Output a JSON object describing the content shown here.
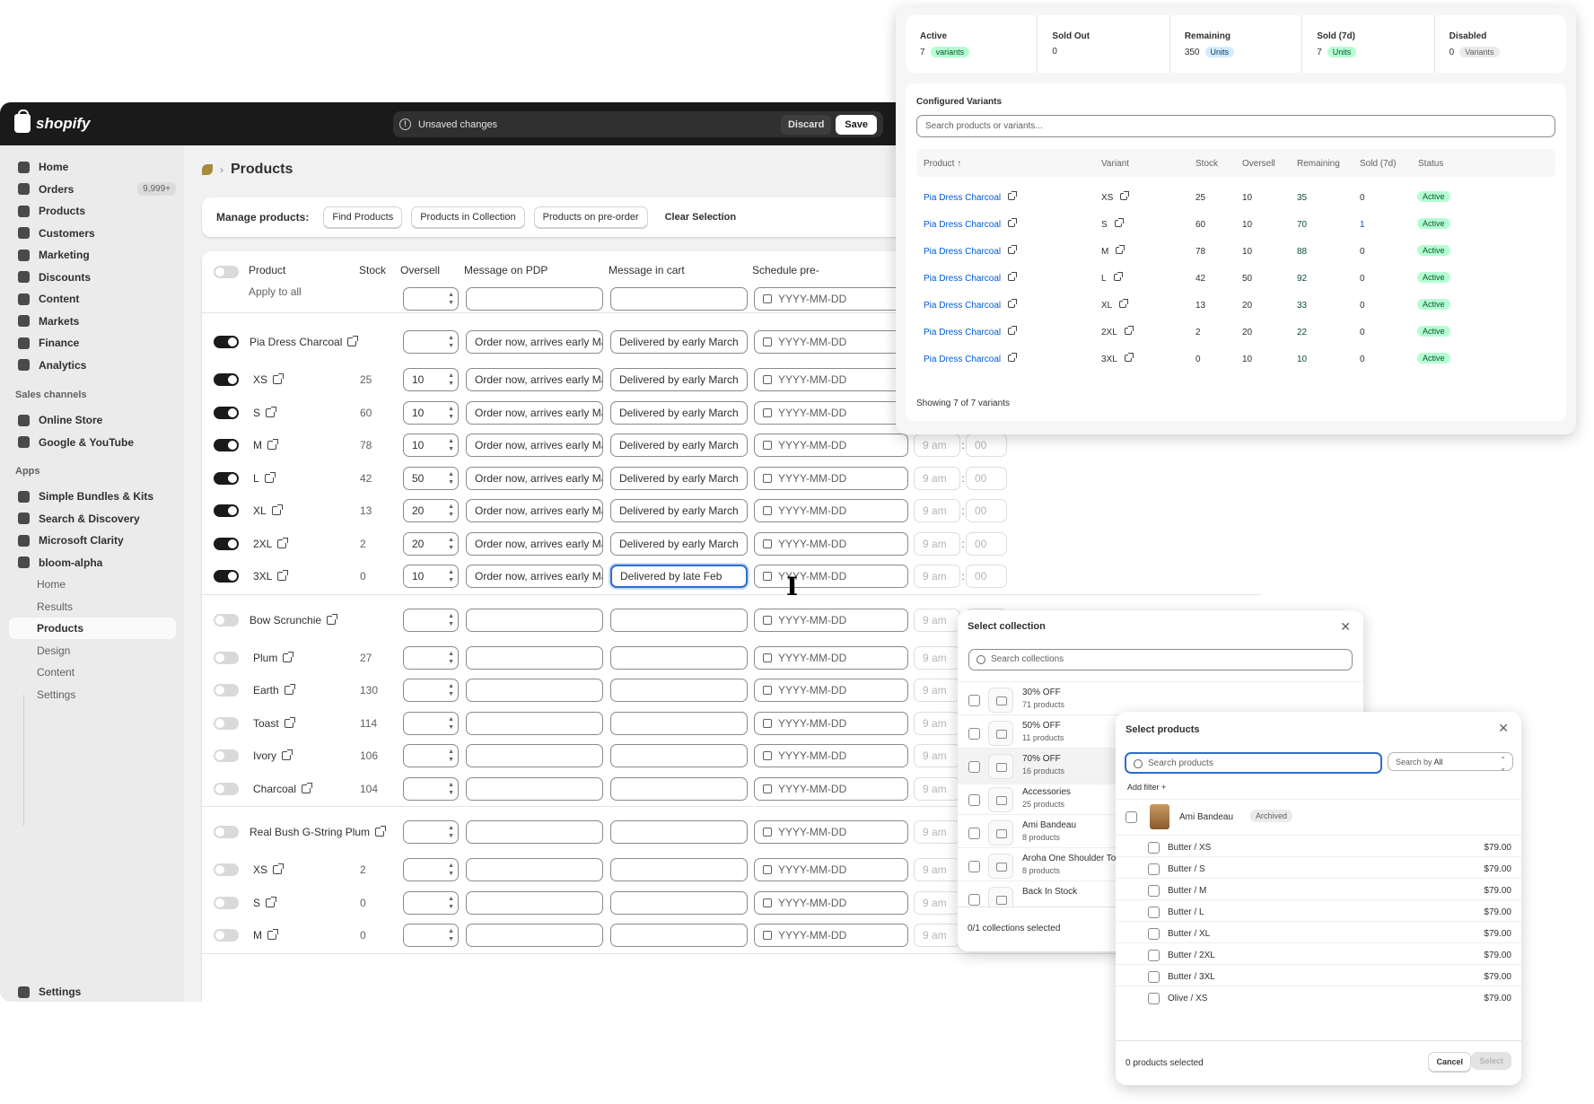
{
  "topbar": {
    "brand": "shopify",
    "unsaved": "Unsaved changes",
    "discard": "Discard",
    "save": "Save"
  },
  "sidebar": {
    "main": [
      {
        "label": "Home"
      },
      {
        "label": "Orders",
        "badge": "9,999+"
      },
      {
        "label": "Products"
      },
      {
        "label": "Customers"
      },
      {
        "label": "Marketing"
      },
      {
        "label": "Discounts"
      },
      {
        "label": "Content"
      },
      {
        "label": "Markets"
      },
      {
        "label": "Finance"
      },
      {
        "label": "Analytics"
      }
    ],
    "sales_heading": "Sales channels",
    "sales": [
      {
        "label": "Online Store"
      },
      {
        "label": "Google & YouTube"
      }
    ],
    "apps_heading": "Apps",
    "apps": [
      {
        "label": "Simple Bundles & Kits"
      },
      {
        "label": "Search & Discovery"
      },
      {
        "label": "Microsoft Clarity"
      },
      {
        "label": "bloom-alpha"
      }
    ],
    "app_sub": [
      {
        "label": "Home"
      },
      {
        "label": "Results"
      },
      {
        "label": "Products"
      },
      {
        "label": "Design"
      },
      {
        "label": "Content"
      },
      {
        "label": "Settings"
      }
    ],
    "settings": "Settings"
  },
  "page": {
    "title": "Products"
  },
  "manage": {
    "label": "Manage products:",
    "find": "Find Products",
    "in_collection": "Products in Collection",
    "preorder": "Products on pre-order",
    "clear": "Clear Selection"
  },
  "table": {
    "headers": {
      "product": "Product",
      "stock": "Stock",
      "oversell": "Oversell",
      "pdp": "Message on PDP",
      "cart": "Message in cart",
      "schedule": "Schedule pre-",
      "apply": "Apply to all"
    },
    "date_placeholder": "YYYY-MM-DD",
    "time": "9 am",
    "minutes": "00",
    "colon": ":",
    "groups": [
      {
        "name": "Pia Dress Charcoal",
        "on": true,
        "pdp": "Order now, arrives early Mar",
        "cart": "Delivered by early March",
        "variants": [
          {
            "name": "XS",
            "stock": "25",
            "oversell": "10",
            "pdp": "Order now, arrives early Mar",
            "cart": "Delivered by early March"
          },
          {
            "name": "S",
            "stock": "60",
            "oversell": "10",
            "pdp": "Order now, arrives early Mar",
            "cart": "Delivered by early March"
          },
          {
            "name": "M",
            "stock": "78",
            "oversell": "10",
            "pdp": "Order now, arrives early Mar",
            "cart": "Delivered by early March"
          },
          {
            "name": "L",
            "stock": "42",
            "oversell": "50",
            "pdp": "Order now, arrives early Mar",
            "cart": "Delivered by early March"
          },
          {
            "name": "XL",
            "stock": "13",
            "oversell": "20",
            "pdp": "Order now, arrives early Mar",
            "cart": "Delivered by early March"
          },
          {
            "name": "2XL",
            "stock": "2",
            "oversell": "20",
            "pdp": "Order now, arrives early Mar",
            "cart": "Delivered by early March"
          },
          {
            "name": "3XL",
            "stock": "0",
            "oversell": "10",
            "pdp": "Order now, arrives early Mar",
            "cart": "Delivered by late Feb"
          }
        ]
      },
      {
        "name": "Bow Scrunchie",
        "on": false,
        "variants": [
          {
            "name": "Plum",
            "stock": "27"
          },
          {
            "name": "Earth",
            "stock": "130"
          },
          {
            "name": "Toast",
            "stock": "114"
          },
          {
            "name": "Ivory",
            "stock": "106"
          },
          {
            "name": "Charcoal",
            "stock": "104"
          }
        ]
      },
      {
        "name": "Real Bush G-String Plum",
        "on": false,
        "variants": [
          {
            "name": "XS",
            "stock": "2"
          },
          {
            "name": "S",
            "stock": "0"
          },
          {
            "name": "M",
            "stock": "0"
          }
        ]
      }
    ]
  },
  "stats": [
    {
      "title": "Active",
      "value": "7",
      "unit": "variants",
      "style": "green"
    },
    {
      "title": "Sold Out",
      "value": "0",
      "unit": "",
      "style": ""
    },
    {
      "title": "Remaining",
      "value": "350",
      "unit": "Units",
      "style": "blue"
    },
    {
      "title": "Sold (7d)",
      "value": "7",
      "unit": "Units",
      "style": "green"
    },
    {
      "title": "Disabled",
      "value": "0",
      "unit": "Variants",
      "style": "gray"
    }
  ],
  "configured": {
    "title": "Configured Variants",
    "search_placeholder": "Search products or variants...",
    "headers": {
      "product": "Product",
      "variant": "Variant",
      "stock": "Stock",
      "oversell": "Oversell",
      "remaining": "Remaining",
      "sold": "Sold (7d)",
      "status": "Status"
    },
    "rows": [
      {
        "product": "Pia Dress Charcoal",
        "variant": "XS",
        "stock": "25",
        "oversell": "10",
        "remaining": "35",
        "sold": "0",
        "status": "Active"
      },
      {
        "product": "Pia Dress Charcoal",
        "variant": "S",
        "stock": "60",
        "oversell": "10",
        "remaining": "70",
        "sold": "1",
        "status": "Active"
      },
      {
        "product": "Pia Dress Charcoal",
        "variant": "M",
        "stock": "78",
        "oversell": "10",
        "remaining": "88",
        "sold": "0",
        "status": "Active"
      },
      {
        "product": "Pia Dress Charcoal",
        "variant": "L",
        "stock": "42",
        "oversell": "50",
        "remaining": "92",
        "sold": "0",
        "status": "Active"
      },
      {
        "product": "Pia Dress Charcoal",
        "variant": "XL",
        "stock": "13",
        "oversell": "20",
        "remaining": "33",
        "sold": "0",
        "status": "Active"
      },
      {
        "product": "Pia Dress Charcoal",
        "variant": "2XL",
        "stock": "2",
        "oversell": "20",
        "remaining": "22",
        "sold": "0",
        "status": "Active"
      },
      {
        "product": "Pia Dress Charcoal",
        "variant": "3XL",
        "stock": "0",
        "oversell": "10",
        "remaining": "10",
        "sold": "0",
        "status": "Active"
      }
    ],
    "showing": "Showing 7 of 7 variants"
  },
  "collections": {
    "title": "Select collection",
    "search_placeholder": "Search collections",
    "items": [
      {
        "name": "30% OFF",
        "count": "71 products"
      },
      {
        "name": "50% OFF",
        "count": "11 products"
      },
      {
        "name": "70% OFF",
        "count": "16 products"
      },
      {
        "name": "Accessories",
        "count": "25 products"
      },
      {
        "name": "Ami Bandeau",
        "count": "8 products"
      },
      {
        "name": "Aroha One Shoulder To",
        "count": "8 products"
      },
      {
        "name": "Back In Stock",
        "count": ""
      }
    ],
    "footer": "0/1 collections selected"
  },
  "products": {
    "title": "Select products",
    "search_placeholder": "Search products",
    "search_by_label": "Search by",
    "search_by_value": "All",
    "add_filter": "Add filter +",
    "parent": {
      "name": "Ami Bandeau",
      "badge": "Archived"
    },
    "rows": [
      {
        "name": "Butter  /  XS",
        "price": "$79.00"
      },
      {
        "name": "Butter  /  S",
        "price": "$79.00"
      },
      {
        "name": "Butter  /  M",
        "price": "$79.00"
      },
      {
        "name": "Butter  /  L",
        "price": "$79.00"
      },
      {
        "name": "Butter  /  XL",
        "price": "$79.00"
      },
      {
        "name": "Butter  /  2XL",
        "price": "$79.00"
      },
      {
        "name": "Butter  /  3XL",
        "price": "$79.00"
      },
      {
        "name": "Olive  /  XS",
        "price": "$79.00"
      }
    ],
    "footer": "0 products selected",
    "cancel": "Cancel",
    "select": "Select"
  }
}
